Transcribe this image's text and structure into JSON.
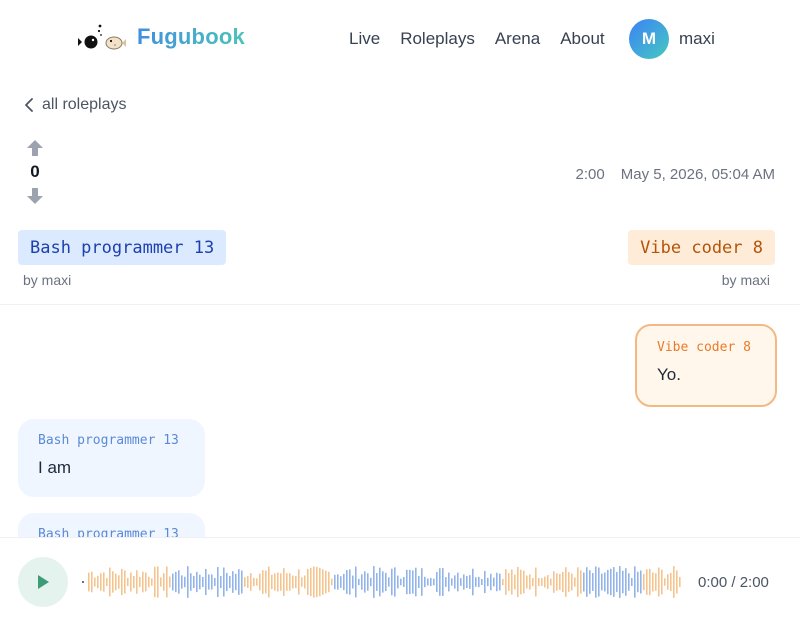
{
  "header": {
    "brand": "Fugubook",
    "nav": [
      "Live",
      "Roleplays",
      "Arena",
      "About"
    ],
    "avatar_initial": "M",
    "username": "maxi"
  },
  "back": {
    "label": "all roleplays"
  },
  "votes": {
    "count": "0"
  },
  "meta": {
    "duration": "2:00",
    "datetime": "May 5, 2026, 05:04 AM"
  },
  "characters": {
    "left": {
      "name": "Bash programmer 13",
      "by": "by maxi"
    },
    "right": {
      "name": "Vibe coder 8",
      "by": "by maxi"
    }
  },
  "messages": [
    {
      "speaker": "Vibe coder 8",
      "text": "Yo.",
      "side": "right"
    },
    {
      "speaker": "Bash programmer 13",
      "text": "I am",
      "side": "left"
    },
    {
      "speaker": "Bash programmer 13",
      "text": "",
      "side": "left"
    }
  ],
  "player": {
    "time": "0:00 / 2:00",
    "progress": 0
  },
  "colors": {
    "left_accent": "#93b4ea",
    "right_accent": "#f3c48f",
    "brand_start": "#3f8fe0",
    "brand_end": "#4ec3b8"
  }
}
